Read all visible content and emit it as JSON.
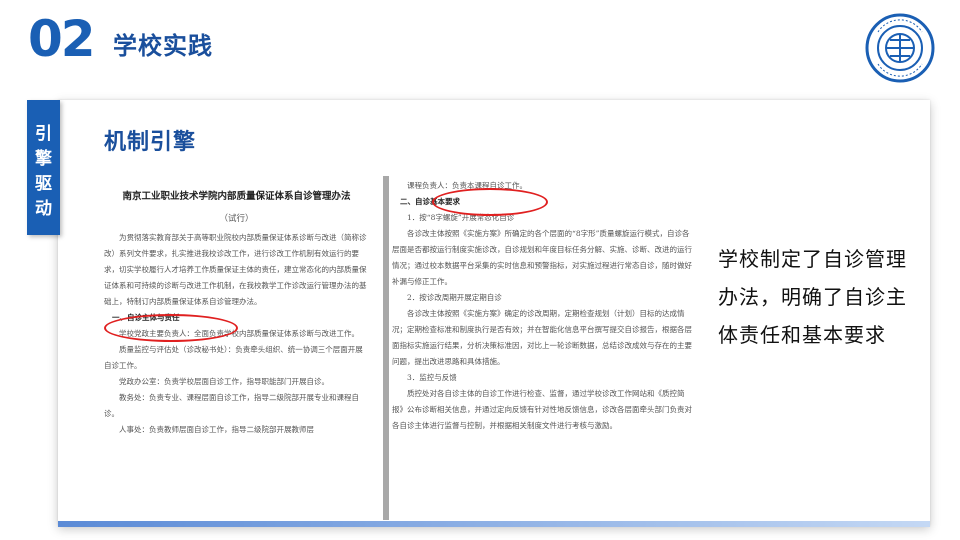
{
  "header": {
    "number": "02",
    "section_title": "学校实践"
  },
  "side_tab": {
    "label": "引擎驱动"
  },
  "subtitle": "机制引擎",
  "doc_left": {
    "title": "南京工业职业技术学院内部质量保证体系自诊管理办法",
    "subtitle": "（试行）",
    "paragraphs": [
      "为贯彻落实教育部关于高等职业院校内部质量保证体系诊断与改进（简称诊改）系列文件要求，扎实推进我校诊改工作，进行诊改工作机制有效运行的要求，切实学校履行人才培养工作质量保证主体的责任，建立常态化的内部质量保证体系和可持续的诊断与改进工作机制，在我校教学工作诊改运行管理办法的基础上，特制订内部质量保证体系自诊管理办法。",
      "一、自诊主体与责任",
      "学校党政主要负责人：全面负责学校内部质量保证体系诊断与改进工作。",
      "质量监控与评估处（诊改秘书处）：负责牵头组织、统一协调三个层面开展自诊工作。",
      "党政办公室：负责学校层面自诊工作，指导职能部门开展自诊。",
      "教务处：负责专业、课程层面自诊工作，指导二级院部开展专业和课程自诊。",
      "人事处：负责教师层面自诊工作，指导二级院部开展教师层"
    ]
  },
  "doc_right": {
    "paragraphs": [
      "课程负责人：负责本课程自诊工作。",
      "二、自诊基本要求",
      "1．按“8字螺旋”开展常态化自诊",
      "各诊改主体按照《实施方案》所确定的各个层面的“8字形”质量螺旋运行模式，自诊各层面是否都按运行制度实施诊改，自诊规划和年度目标任务分解、实施、诊断、改进的运行情况；通过校本数据平台采集的实时信息和预警指标，对实施过程进行常态自诊，随时做好补漏与修正工作。",
      "2．按诊改周期开展定期自诊",
      "各诊改主体按照《实施方案》确定的诊改周期，定期检查规划（计划）目标的达成情况；定期检查标准和制度执行是否有效；并在智能化信息平台撰写提交自诊报告，根据各层面指标实施运行结果，分析决策标准因，对比上一轮诊断数据，总结诊改成效与存在的主要问题，提出改进思路和具体措施。",
      "3．监控与反馈",
      "质控处对各自诊主体的自诊工作进行检查、监督，通过学校诊改工作网站和《质控简报》公布诊断相关信息，并通过定向反馈有针对性地反馈信息，诊改各层面牵头部门负责对各自诊主体进行监督与控制，并根据相关制度文件进行考核与激励。"
    ]
  },
  "summary_text": "学校制定了自诊管理办法，明确了自诊主体责任和基本要求",
  "colors": {
    "brand": "#1a5fb4",
    "highlight": "#e02020"
  },
  "icons": {
    "logo": "school-emblem-icon"
  }
}
